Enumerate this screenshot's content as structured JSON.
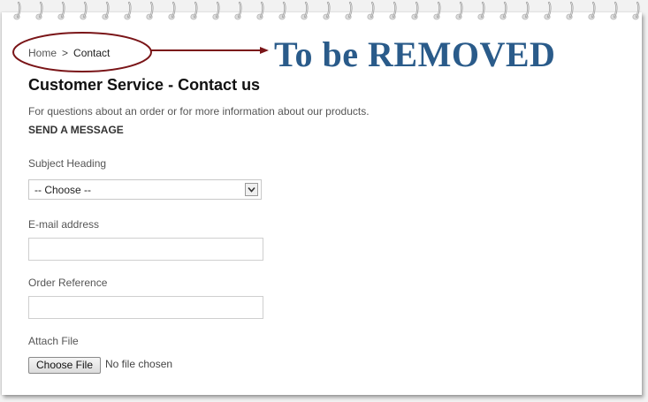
{
  "breadcrumb": {
    "home": "Home",
    "separator": ">",
    "current": "Contact"
  },
  "annotation": {
    "text": "To be REMOVED",
    "color": "#2a5b8a",
    "marker_color": "#7a1518"
  },
  "page": {
    "title": "Customer Service - Contact us",
    "intro": "For questions about an order or for more information about our products.",
    "section_heading": "SEND A MESSAGE"
  },
  "form": {
    "subject_label": "Subject Heading",
    "subject_value": "-- Choose --",
    "email_label": "E-mail address",
    "email_value": "",
    "order_label": "Order Reference",
    "order_value": "",
    "attach_label": "Attach File",
    "file_button": "Choose File",
    "file_status": "No file chosen"
  }
}
